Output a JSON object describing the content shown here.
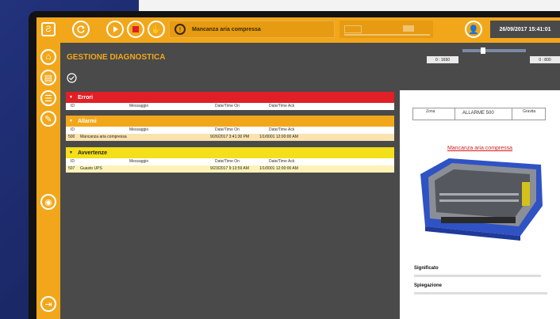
{
  "topbar": {
    "alert_message": "Mancanza aria compressa",
    "datetime": "26/09/2017 15:41:01"
  },
  "page": {
    "title": "GESTIONE DIAGNOSTICA"
  },
  "readouts": {
    "left": "0 : 1650",
    "right": "0 : 800"
  },
  "panels": {
    "errors": {
      "title": "Errori",
      "color": "#e01f26",
      "columns": [
        "ID",
        "Messaggio",
        "Date/Time On",
        "Date/Time Ack"
      ],
      "rows": []
    },
    "alarms": {
      "title": "Allarmi",
      "color": "#f2a71b",
      "columns": [
        "ID",
        "Messaggio",
        "Date/Time On",
        "Date/Time Ack"
      ],
      "rows": [
        {
          "id": "500",
          "message": "Mancanza aria compressa",
          "on": "9/26/2017 3:41:30 PM",
          "ack": "1/1/0001 12:00:00 AM"
        }
      ]
    },
    "warnings": {
      "title": "Avvertenze",
      "color": "#f3df1a",
      "columns": [
        "ID",
        "Messaggio",
        "Date/Time On",
        "Date/Time Ack"
      ],
      "rows": [
        {
          "id": "507",
          "message": "Guasto UPS",
          "on": "9/23/2017 9:13:59 AM",
          "ack": "1/1/0001 12:00:00 AM"
        }
      ]
    }
  },
  "document": {
    "table_headers": [
      "Zona",
      "ALLARME 500",
      "Gravita"
    ],
    "title": "Mancanza aria compressa",
    "section1": "Significato",
    "section2": "Spiegazione"
  },
  "colors": {
    "accent": "#f2a71b",
    "background": "#4a4a4a"
  }
}
